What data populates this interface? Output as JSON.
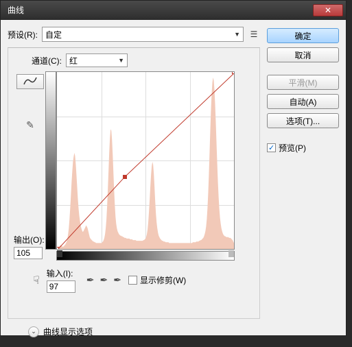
{
  "window": {
    "title": "曲线"
  },
  "preset": {
    "label": "预设(R):",
    "value": "自定"
  },
  "channel": {
    "label": "通道(C):",
    "value": "红"
  },
  "output": {
    "label": "输出(O):",
    "value": "105"
  },
  "input": {
    "label": "输入(I):",
    "value": "97"
  },
  "show_clipping": {
    "label": "显示修剪(W)",
    "checked": false
  },
  "disclosure": {
    "label": "曲线显示选项"
  },
  "buttons": {
    "ok": "确定",
    "cancel": "取消",
    "smooth": "平滑(M)",
    "auto": "自动(A)",
    "options": "选项(T)..."
  },
  "preview": {
    "label": "预览(P)",
    "checked": true
  },
  "chart_data": {
    "type": "line",
    "title": "",
    "xlabel": "输入",
    "ylabel": "输出",
    "xlim": [
      0,
      255
    ],
    "ylim": [
      0,
      255
    ],
    "channel": "red",
    "curve_points": [
      {
        "x": 0,
        "y": 0
      },
      {
        "x": 97,
        "y": 105
      },
      {
        "x": 255,
        "y": 255
      }
    ],
    "histogram_bins": [
      2,
      2,
      3,
      3,
      4,
      5,
      5,
      4,
      3,
      3,
      4,
      5,
      6,
      8,
      10,
      14,
      20,
      28,
      40,
      55,
      72,
      90,
      105,
      118,
      125,
      130,
      126,
      115,
      100,
      84,
      68,
      55,
      45,
      38,
      32,
      28,
      25,
      23,
      24,
      26,
      28,
      30,
      32,
      30,
      28,
      24,
      20,
      16,
      14,
      13,
      12,
      11,
      10,
      10,
      9,
      9,
      8,
      8,
      8,
      8,
      8,
      8,
      8,
      8,
      8,
      9,
      10,
      12,
      15,
      20,
      28,
      40,
      58,
      80,
      105,
      130,
      150,
      162,
      160,
      148,
      128,
      104,
      80,
      60,
      44,
      34,
      28,
      24,
      22,
      20,
      19,
      18,
      18,
      17,
      17,
      16,
      16,
      15,
      15,
      15,
      14,
      14,
      14,
      14,
      14,
      13,
      13,
      13,
      13,
      12,
      12,
      12,
      12,
      12,
      11,
      11,
      11,
      11,
      11,
      11,
      11,
      11,
      11,
      11,
      12,
      12,
      13,
      14,
      16,
      20,
      26,
      36,
      50,
      66,
      84,
      100,
      112,
      118,
      114,
      102,
      84,
      64,
      48,
      36,
      28,
      22,
      18,
      16,
      14,
      13,
      12,
      11,
      11,
      10,
      10,
      10,
      9,
      9,
      9,
      9,
      9,
      8,
      8,
      8,
      8,
      8,
      8,
      8,
      8,
      8,
      8,
      8,
      8,
      8,
      8,
      8,
      8,
      8,
      8,
      8,
      8,
      8,
      8,
      8,
      8,
      8,
      8,
      8,
      8,
      8,
      8,
      8,
      8,
      8,
      8,
      9,
      9,
      9,
      9,
      9,
      10,
      10,
      10,
      10,
      11,
      11,
      12,
      12,
      13,
      14,
      15,
      17,
      20,
      24,
      30,
      40,
      55,
      75,
      100,
      130,
      160,
      188,
      210,
      225,
      232,
      228,
      215,
      195,
      170,
      142,
      115,
      90,
      70,
      54,
      42,
      34,
      28,
      24,
      21,
      19,
      18,
      17,
      17,
      16,
      16,
      16,
      16,
      15,
      15,
      15,
      14,
      13,
      12,
      10,
      8
    ]
  }
}
